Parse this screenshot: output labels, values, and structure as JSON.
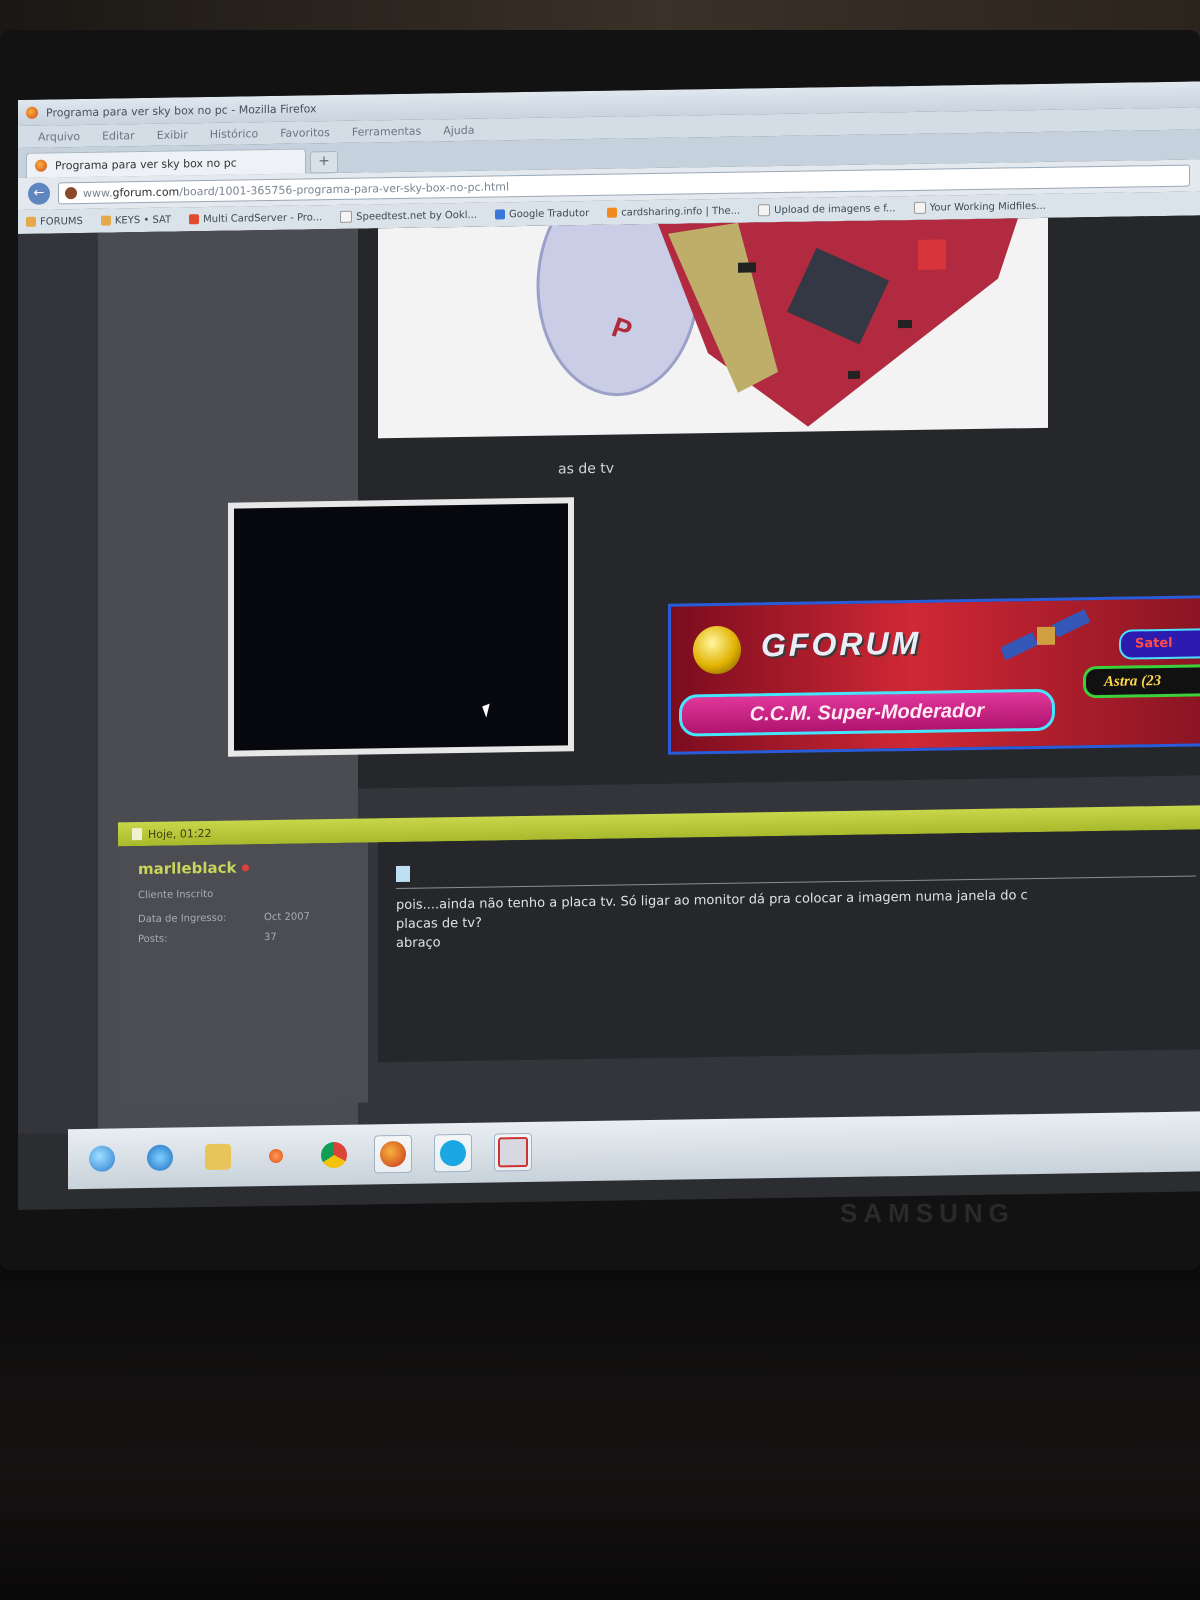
{
  "monitor": {
    "brand": "SAMSUNG"
  },
  "browser": {
    "window_title": "Programa para ver sky box no pc - Mozilla Firefox",
    "menu": [
      "Arquivo",
      "Editar",
      "Exibir",
      "Histórico",
      "Favoritos",
      "Ferramentas",
      "Ajuda"
    ],
    "tab_title": "Programa para ver sky box no pc",
    "new_tab_label": "+",
    "url_prefix": "www.",
    "url_host": "gforum.com",
    "url_path": "/board/1001-365756-programa-para-ver-sky-box-no-pc.html",
    "back_label": "←",
    "bookmarks": [
      "FORUMS",
      "KEYS • SAT",
      "Multi CardServer - Pro...",
      "Speedtest.net by Ookl...",
      "Google Tradutor",
      "cardsharing.info | The...",
      "Upload de imagens e f...",
      "Your Working Midfiles..."
    ]
  },
  "post1": {
    "text_fragment": "as de tv",
    "signature": {
      "logo": "GFORUM",
      "rank": "C.C.M. Super-Moderador",
      "pill1": "Satel",
      "pill2": "Astra (23"
    }
  },
  "post2": {
    "header_time": "Hoje, 01:22",
    "username": "marlleblack",
    "user_rank": "Cliente Inscrito",
    "join_label": "Data de Ingresso:",
    "join_value": "Oct 2007",
    "posts_label": "Posts:",
    "posts_value": "37",
    "body": "pois....ainda não tenho a placa tv. Só ligar ao monitor dá pra colocar a imagem numa janela do c\nplacas de tv?\nabraço"
  },
  "taskbar": {
    "items": [
      "start-orb",
      "internet-explorer",
      "folder",
      "media-player",
      "chrome",
      "firefox",
      "skype",
      "tv-app"
    ]
  },
  "colors": {
    "forum_bg": "#26272b",
    "header_bar": "#b6c63a",
    "username": "#c9d65a",
    "sig_border": "#2a5bd8"
  }
}
